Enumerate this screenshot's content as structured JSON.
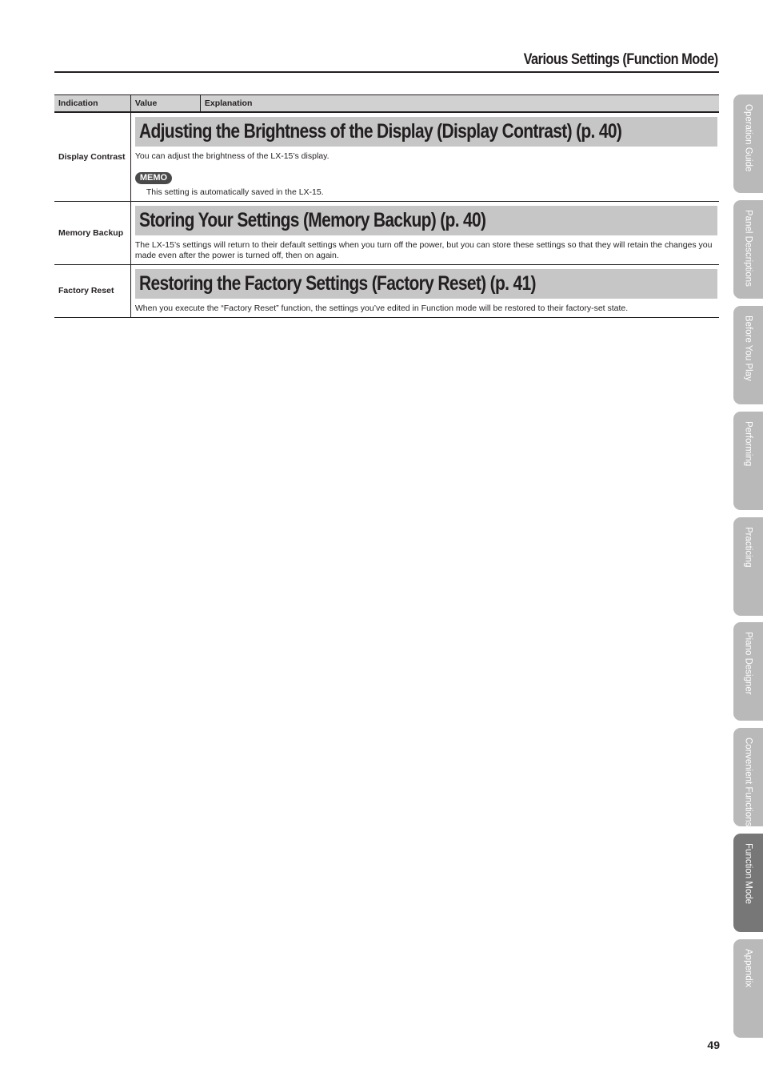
{
  "header": {
    "title": "Various Settings (Function Mode)"
  },
  "table": {
    "columns": [
      "Indication",
      "Value",
      "Explanation"
    ],
    "rows": [
      {
        "indication": "Display Contrast",
        "heading": "Adjusting the Brightness of the Display (Display Contrast) (p. 40)",
        "description": "You can adjust the brightness of the LX-15’s display.",
        "memo_label": "MEMO",
        "memo_text": "This setting is automatically saved in the LX-15."
      },
      {
        "indication": "Memory Backup",
        "heading": "Storing Your Settings (Memory Backup) (p. 40)",
        "description": "The LX-15’s settings will return to their default settings when you turn off the power, but you can store these settings so that they will retain the changes you made even after the power is turned off, then on again."
      },
      {
        "indication": "Factory Reset",
        "heading": "Restoring the Factory Settings (Factory Reset) (p. 41)",
        "description": "When you execute the “Factory Reset” function, the settings you’ve edited in Function mode will be restored to their factory-set state."
      }
    ]
  },
  "side_tabs": [
    {
      "label": "Operation Guide",
      "active": false
    },
    {
      "label": "Panel Descriptions",
      "active": false
    },
    {
      "label": "Before You Play",
      "active": false
    },
    {
      "label": "Performing",
      "active": false
    },
    {
      "label": "Practicing",
      "active": false
    },
    {
      "label": "Piano Designer",
      "active": false
    },
    {
      "label": "Convenient Functions",
      "active": false
    },
    {
      "label": "Function Mode",
      "active": true
    },
    {
      "label": "Appendix",
      "active": false
    }
  ],
  "page_number": "49"
}
